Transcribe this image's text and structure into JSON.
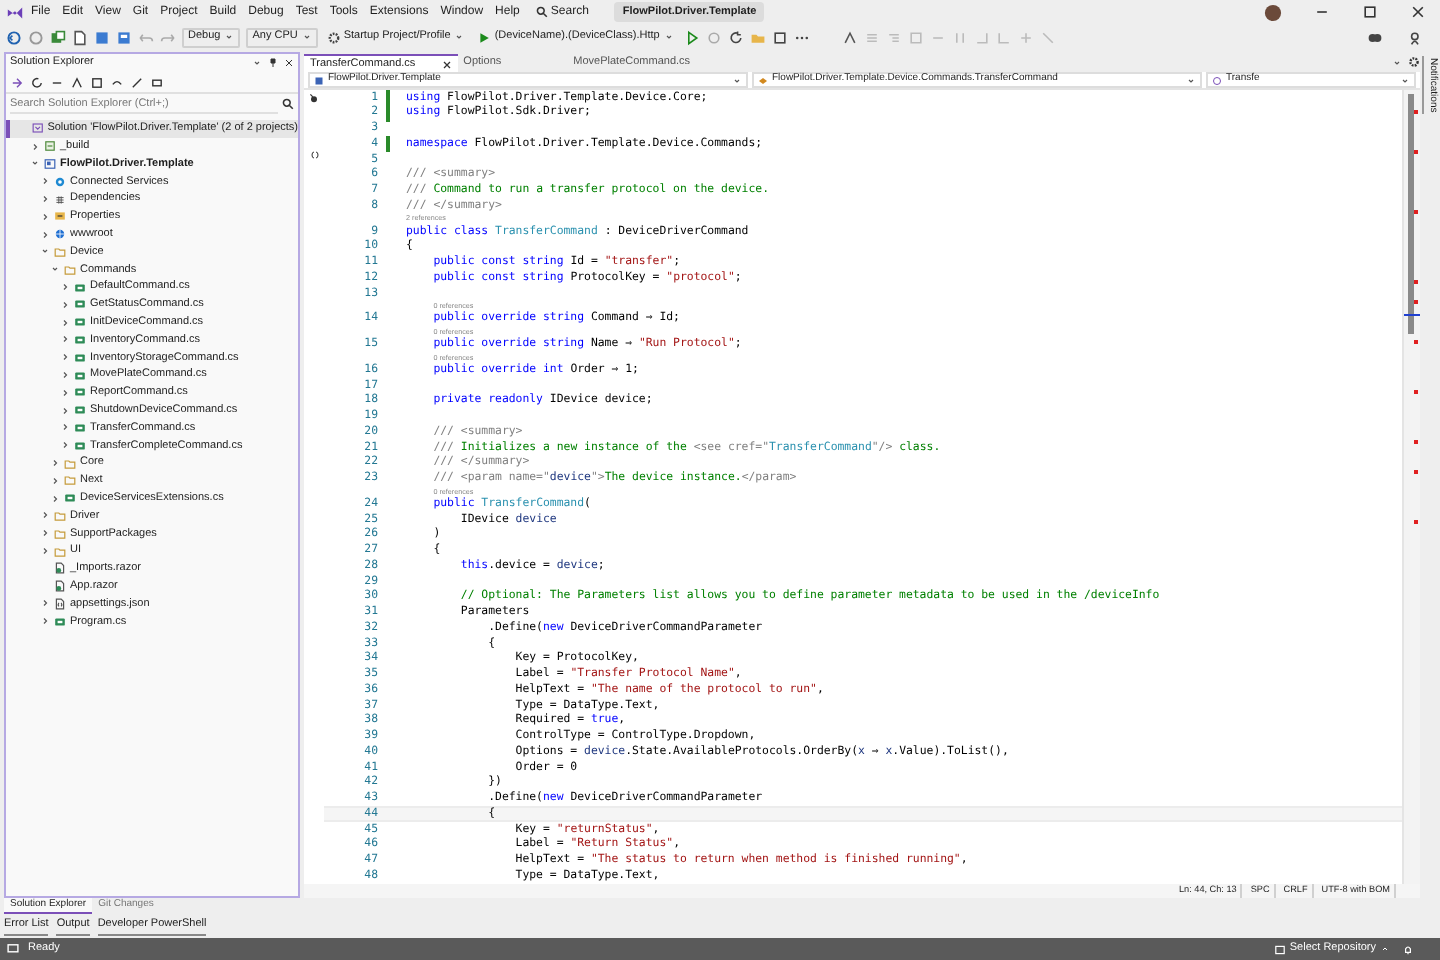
{
  "menu": [
    "File",
    "Edit",
    "View",
    "Git",
    "Project",
    "Build",
    "Debug",
    "Test",
    "Tools",
    "Extensions",
    "Window",
    "Help"
  ],
  "search": {
    "label": "Search"
  },
  "window": {
    "title": "FlowPilot.Driver.Template"
  },
  "toolbar": {
    "configuration": "Debug",
    "platform": "Any CPU",
    "startup": "Startup Project/Profile",
    "run": "(DeviceName).(DeviceClass).Http"
  },
  "solution_explorer": {
    "title": "Solution Explorer",
    "search": {
      "placeholder": "Search Solution Explorer (Ctrl+;)"
    },
    "solution": {
      "label": "Solution 'FlowPilot.Driver.Template' (2 of 2 projects)",
      "selected": true
    },
    "items": [
      {
        "label": "_build",
        "kind": "build",
        "expanded": false
      },
      {
        "label": "FlowPilot.Driver.Template",
        "kind": "project",
        "expanded": true,
        "children": [
          {
            "label": "Connected Services",
            "kind": "services",
            "expanded": false
          },
          {
            "label": "Dependencies",
            "kind": "deps",
            "expanded": false
          },
          {
            "label": "Properties",
            "kind": "properties",
            "expanded": false
          },
          {
            "label": "wwwroot",
            "kind": "web",
            "expanded": false
          },
          {
            "label": "Device",
            "kind": "folder",
            "expanded": true,
            "children": [
              {
                "label": "Commands",
                "kind": "folder",
                "expanded": true,
                "children": [
                  {
                    "label": "DefaultCommand.cs",
                    "kind": "cs",
                    "expanded": false
                  },
                  {
                    "label": "GetStatusCommand.cs",
                    "kind": "cs",
                    "expanded": false
                  },
                  {
                    "label": "InitDeviceCommand.cs",
                    "kind": "cs",
                    "expanded": false
                  },
                  {
                    "label": "InventoryCommand.cs",
                    "kind": "cs",
                    "expanded": false
                  },
                  {
                    "label": "InventoryStorageCommand.cs",
                    "kind": "cs",
                    "expanded": false
                  },
                  {
                    "label": "MovePlateCommand.cs",
                    "kind": "cs",
                    "expanded": false
                  },
                  {
                    "label": "ReportCommand.cs",
                    "kind": "cs",
                    "expanded": false
                  },
                  {
                    "label": "ShutdownDeviceCommand.cs",
                    "kind": "cs",
                    "expanded": false
                  },
                  {
                    "label": "TransferCommand.cs",
                    "kind": "cs",
                    "expanded": false
                  },
                  {
                    "label": "TransferCompleteCommand.cs",
                    "kind": "cs",
                    "expanded": false
                  }
                ]
              },
              {
                "label": "Core",
                "kind": "folder",
                "expanded": false
              },
              {
                "label": "Next",
                "kind": "folder",
                "expanded": false
              },
              {
                "label": "DeviceServicesExtensions.cs",
                "kind": "cs",
                "expanded": false
              }
            ]
          },
          {
            "label": "Driver",
            "kind": "folder",
            "expanded": false
          },
          {
            "label": "SupportPackages",
            "kind": "folder",
            "expanded": false
          },
          {
            "label": "UI",
            "kind": "folder",
            "expanded": false
          },
          {
            "label": "_Imports.razor",
            "kind": "razor"
          },
          {
            "label": "App.razor",
            "kind": "razor"
          },
          {
            "label": "appsettings.json",
            "kind": "json",
            "expanded": false
          },
          {
            "label": "Program.cs",
            "kind": "cs",
            "expanded": false
          }
        ]
      }
    ],
    "tabs": [
      {
        "label": "Solution Explorer",
        "selected": true
      },
      {
        "label": "Git Changes",
        "selected": false
      }
    ]
  },
  "editor": {
    "tabs": [
      {
        "label": "TransferCommand.cs",
        "selected": true
      },
      {
        "label": "Options",
        "selected": false
      },
      {
        "label": "MovePlateCommand.cs",
        "selected": false
      }
    ],
    "nav": [
      "FlowPilot.Driver.Template",
      "FlowPilot.Driver.Template.Device.Commands.TransferCommand",
      "Transfe"
    ],
    "lines": [
      {
        "n": "1",
        "changed": true,
        "current": false,
        "tokens": [
          {
            "kind": "keyword",
            "text": "using "
          },
          {
            "kind": "plain",
            "text": "FlowPilot.Driver.Template.Device.Core;"
          }
        ]
      },
      {
        "n": "2",
        "changed": true,
        "current": false,
        "tokens": [
          {
            "kind": "keyword",
            "text": "using "
          },
          {
            "kind": "plain",
            "text": "FlowPilot.Sdk.Driver;"
          }
        ]
      },
      {
        "n": "3",
        "changed": false,
        "current": false
      },
      {
        "n": "4",
        "changed": true,
        "current": false,
        "tokens": [
          {
            "kind": "keyword",
            "text": "namespace "
          },
          {
            "kind": "plain",
            "text": "FlowPilot.Driver.Template.Device.Commands;"
          }
        ]
      },
      {
        "n": "5",
        "changed": false,
        "current": false
      },
      {
        "n": "6",
        "changed": false,
        "current": false,
        "tokens": [
          {
            "kind": "doc",
            "text": "/// <summary>"
          }
        ]
      },
      {
        "n": "7",
        "changed": false,
        "current": false,
        "tokens": [
          {
            "kind": "doc",
            "text": "/// "
          },
          {
            "kind": "comment",
            "text": "Command to run a transfer protocol on the device."
          }
        ]
      },
      {
        "n": "8",
        "changed": false,
        "current": false,
        "tokens": [
          {
            "kind": "doc",
            "text": "/// </summary>"
          }
        ]
      },
      {
        "n": "9",
        "changed": false,
        "current": false,
        "refs": "2 references",
        "tokens": [
          {
            "kind": "keyword",
            "text": "public class "
          },
          {
            "kind": "type",
            "text": "TransferCommand"
          },
          {
            "kind": "plain",
            "text": " : DeviceDriverCommand"
          }
        ]
      },
      {
        "n": "10",
        "changed": false,
        "current": false,
        "tokens": [
          {
            "kind": "plain",
            "text": "{"
          }
        ]
      },
      {
        "n": "11",
        "changed": false,
        "current": false,
        "tokens": [
          {
            "kind": "keyword",
            "text": "    public const string "
          },
          {
            "kind": "plain",
            "text": "Id = "
          },
          {
            "kind": "string",
            "text": "\"transfer\""
          },
          {
            "kind": "plain",
            "text": ";"
          }
        ]
      },
      {
        "n": "12",
        "changed": false,
        "current": false,
        "tokens": [
          {
            "kind": "keyword",
            "text": "    public const string "
          },
          {
            "kind": "plain",
            "text": "ProtocolKey = "
          },
          {
            "kind": "string",
            "text": "\"protocol\""
          },
          {
            "kind": "plain",
            "text": ";"
          }
        ]
      },
      {
        "n": "13",
        "changed": false,
        "current": false
      },
      {
        "n": "14",
        "changed": false,
        "current": false,
        "refs": "0 references",
        "tokens": [
          {
            "kind": "keyword",
            "text": "    public override string "
          },
          {
            "kind": "plain",
            "text": "Command ⇒ Id;"
          }
        ]
      },
      {
        "n": "15",
        "changed": false,
        "current": false,
        "refs": "0 references",
        "tokens": [
          {
            "kind": "keyword",
            "text": "    public override string "
          },
          {
            "kind": "plain",
            "text": "Name ⇒ "
          },
          {
            "kind": "string",
            "text": "\"Run Protocol\""
          },
          {
            "kind": "plain",
            "text": ";"
          }
        ]
      },
      {
        "n": "16",
        "changed": false,
        "current": false,
        "refs": "0 references",
        "tokens": [
          {
            "kind": "keyword",
            "text": "    public override int "
          },
          {
            "kind": "plain",
            "text": "Order ⇒ 1;"
          }
        ]
      },
      {
        "n": "17",
        "changed": false,
        "current": false
      },
      {
        "n": "18",
        "changed": false,
        "current": false,
        "tokens": [
          {
            "kind": "keyword",
            "text": "    private readonly "
          },
          {
            "kind": "plain",
            "text": "IDevice device;"
          }
        ]
      },
      {
        "n": "19",
        "changed": false,
        "current": false
      },
      {
        "n": "20",
        "changed": false,
        "current": false,
        "tokens": [
          {
            "kind": "doc",
            "text": "    /// <summary>"
          }
        ]
      },
      {
        "n": "21",
        "changed": false,
        "current": false,
        "tokens": [
          {
            "kind": "doc",
            "text": "    /// "
          },
          {
            "kind": "comment",
            "text": "Initializes a new instance of the "
          },
          {
            "kind": "doc",
            "text": "<see cref=\""
          },
          {
            "kind": "type",
            "text": "TransferCommand"
          },
          {
            "kind": "doc",
            "text": "\"/>"
          },
          {
            "kind": "comment",
            "text": " class."
          }
        ]
      },
      {
        "n": "22",
        "changed": false,
        "current": false,
        "tokens": [
          {
            "kind": "doc",
            "text": "    /// </summary>"
          }
        ]
      },
      {
        "n": "23",
        "changed": false,
        "current": false,
        "tokens": [
          {
            "kind": "doc",
            "text": "    /// <param name=\""
          },
          {
            "kind": "param",
            "text": "device"
          },
          {
            "kind": "doc",
            "text": "\">"
          },
          {
            "kind": "comment",
            "text": "The device instance."
          },
          {
            "kind": "doc",
            "text": "</param>"
          }
        ]
      },
      {
        "n": "24",
        "changed": false,
        "current": false,
        "refs": "0 references",
        "tokens": [
          {
            "kind": "keyword",
            "text": "    public "
          },
          {
            "kind": "type",
            "text": "TransferCommand"
          },
          {
            "kind": "plain",
            "text": "("
          }
        ]
      },
      {
        "n": "25",
        "changed": false,
        "current": false,
        "tokens": [
          {
            "kind": "plain",
            "text": "        IDevice "
          },
          {
            "kind": "param",
            "text": "device"
          }
        ]
      },
      {
        "n": "26",
        "changed": false,
        "current": false,
        "tokens": [
          {
            "kind": "plain",
            "text": "    )"
          }
        ]
      },
      {
        "n": "27",
        "changed": false,
        "current": false,
        "tokens": [
          {
            "kind": "plain",
            "text": "    {"
          }
        ]
      },
      {
        "n": "28",
        "changed": false,
        "current": false,
        "tokens": [
          {
            "kind": "keyword",
            "text": "        this"
          },
          {
            "kind": "plain",
            "text": ".device = "
          },
          {
            "kind": "param",
            "text": "device"
          },
          {
            "kind": "plain",
            "text": ";"
          }
        ]
      },
      {
        "n": "29",
        "changed": false,
        "current": false
      },
      {
        "n": "30",
        "changed": false,
        "current": false,
        "tokens": [
          {
            "kind": "comment",
            "text": "        // Optional: The Parameters list allows you to define parameter metadata to be used in the /deviceInfo"
          }
        ]
      },
      {
        "n": "31",
        "changed": false,
        "current": false,
        "tokens": [
          {
            "kind": "plain",
            "text": "        Parameters"
          }
        ]
      },
      {
        "n": "32",
        "changed": false,
        "current": false,
        "tokens": [
          {
            "kind": "plain",
            "text": "            .Define("
          },
          {
            "kind": "keyword",
            "text": "new "
          },
          {
            "kind": "plain",
            "text": "DeviceDriverCommandParameter"
          }
        ]
      },
      {
        "n": "33",
        "changed": false,
        "current": false,
        "tokens": [
          {
            "kind": "plain",
            "text": "            {"
          }
        ]
      },
      {
        "n": "34",
        "changed": false,
        "current": false,
        "tokens": [
          {
            "kind": "plain",
            "text": "                Key = ProtocolKey,"
          }
        ]
      },
      {
        "n": "35",
        "changed": false,
        "current": false,
        "tokens": [
          {
            "kind": "plain",
            "text": "                Label = "
          },
          {
            "kind": "string",
            "text": "\"Transfer Protocol Name\""
          },
          {
            "kind": "plain",
            "text": ","
          }
        ]
      },
      {
        "n": "36",
        "changed": false,
        "current": false,
        "tokens": [
          {
            "kind": "plain",
            "text": "                HelpText = "
          },
          {
            "kind": "string",
            "text": "\"The name of the protocol to run\""
          },
          {
            "kind": "plain",
            "text": ","
          }
        ]
      },
      {
        "n": "37",
        "changed": false,
        "current": false,
        "tokens": [
          {
            "kind": "plain",
            "text": "                Type = DataType.Text,"
          }
        ]
      },
      {
        "n": "38",
        "changed": false,
        "current": false,
        "tokens": [
          {
            "kind": "plain",
            "text": "                Required = "
          },
          {
            "kind": "keyword",
            "text": "true"
          },
          {
            "kind": "plain",
            "text": ","
          }
        ]
      },
      {
        "n": "39",
        "changed": false,
        "current": false,
        "tokens": [
          {
            "kind": "plain",
            "text": "                ControlType = ControlType.Dropdown,"
          }
        ]
      },
      {
        "n": "40",
        "changed": false,
        "current": false,
        "tokens": [
          {
            "kind": "plain",
            "text": "                Options = "
          },
          {
            "kind": "param",
            "text": "device"
          },
          {
            "kind": "plain",
            "text": ".State.AvailableProtocols.OrderBy("
          },
          {
            "kind": "param",
            "text": "x"
          },
          {
            "kind": "plain",
            "text": " ⇒ "
          },
          {
            "kind": "param",
            "text": "x"
          },
          {
            "kind": "plain",
            "text": ".Value).ToList(),"
          }
        ]
      },
      {
        "n": "41",
        "changed": false,
        "current": false,
        "tokens": [
          {
            "kind": "plain",
            "text": "                Order = 0"
          }
        ]
      },
      {
        "n": "42",
        "changed": false,
        "current": false,
        "tokens": [
          {
            "kind": "plain",
            "text": "            })"
          }
        ]
      },
      {
        "n": "43",
        "changed": false,
        "current": false,
        "tokens": [
          {
            "kind": "plain",
            "text": "            .Define("
          },
          {
            "kind": "keyword",
            "text": "new "
          },
          {
            "kind": "plain",
            "text": "DeviceDriverCommandParameter"
          }
        ]
      },
      {
        "n": "44",
        "changed": false,
        "current": true,
        "tokens": [
          {
            "kind": "plain",
            "text": "            {"
          }
        ]
      },
      {
        "n": "45",
        "changed": false,
        "current": false,
        "tokens": [
          {
            "kind": "plain",
            "text": "                Key = "
          },
          {
            "kind": "string",
            "text": "\"returnStatus\""
          },
          {
            "kind": "plain",
            "text": ","
          }
        ]
      },
      {
        "n": "46",
        "changed": false,
        "current": false,
        "tokens": [
          {
            "kind": "plain",
            "text": "                Label = "
          },
          {
            "kind": "string",
            "text": "\"Return Status\""
          },
          {
            "kind": "plain",
            "text": ","
          }
        ]
      },
      {
        "n": "47",
        "changed": false,
        "current": false,
        "tokens": [
          {
            "kind": "plain",
            "text": "                HelpText = "
          },
          {
            "kind": "string",
            "text": "\"The status to return when method is finished running\""
          },
          {
            "kind": "plain",
            "text": ","
          }
        ]
      },
      {
        "n": "48",
        "changed": false,
        "current": false,
        "tokens": [
          {
            "kind": "plain",
            "text": "                Type = DataType.Text,"
          }
        ]
      }
    ],
    "status": [
      "Ln: 44, Ch: 13",
      "SPC",
      "CRLF",
      "UTF-8 with BOM"
    ]
  },
  "notifications": {
    "label": "Notifications"
  },
  "tool_tabs": [
    "Error List",
    "Output",
    "Developer PowerShell"
  ],
  "status_bar": {
    "text": "Ready",
    "repository": "Select Repository"
  }
}
